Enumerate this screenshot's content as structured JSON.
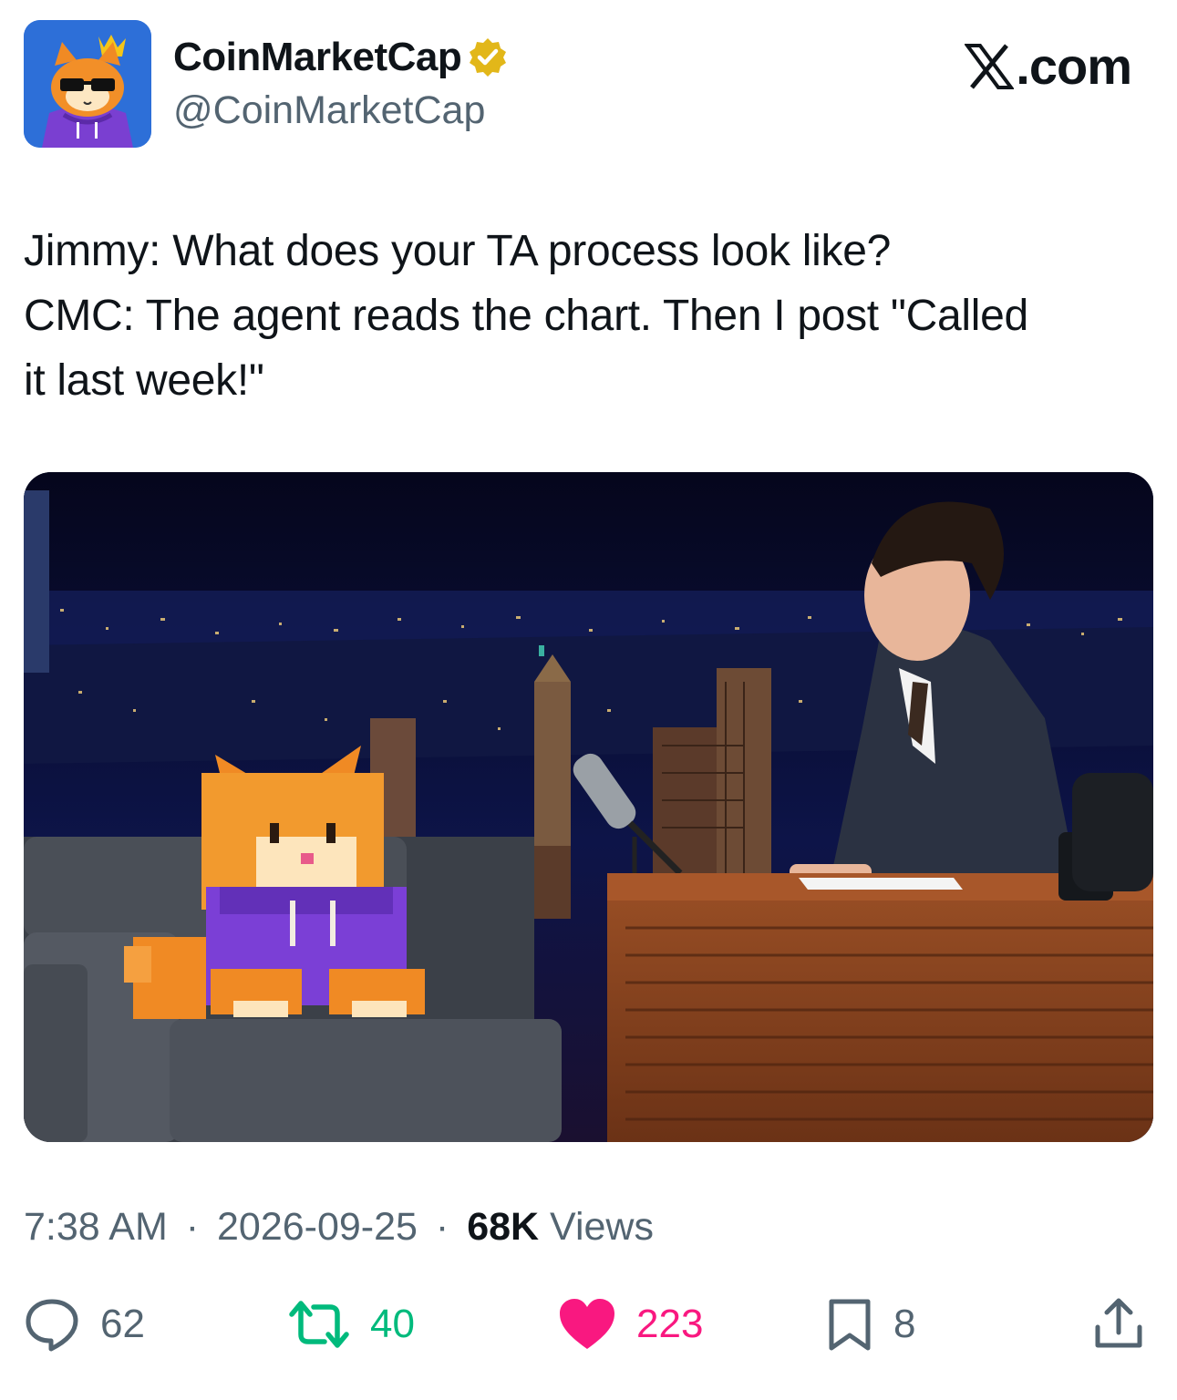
{
  "header": {
    "display_name": "CoinMarketCap",
    "handle": "@CoinMarketCap",
    "verified": true,
    "source_label": ".com",
    "brand_colors": {
      "avatar_bg": "#2d6fd8",
      "verified_badge": "#e2b719"
    }
  },
  "tweet": {
    "lines": [
      "Jimmy: What does your TA process look like?",
      "CMC: The agent reads the chart. Then I post \"Called",
      "it last week!\""
    ]
  },
  "meta": {
    "time": "7:38 AM",
    "date": "2026-09-25",
    "views_count": "68K",
    "views_label": "Views",
    "separator": "·"
  },
  "actions": {
    "replies": "62",
    "reposts": "40",
    "likes": "223",
    "bookmarks": "8",
    "colors": {
      "repost": "#00ba7c",
      "like": "#f91880",
      "muted": "#536471"
    },
    "icons": [
      "reply-icon",
      "repost-icon",
      "heart-icon",
      "bookmark-icon",
      "share-icon"
    ]
  }
}
